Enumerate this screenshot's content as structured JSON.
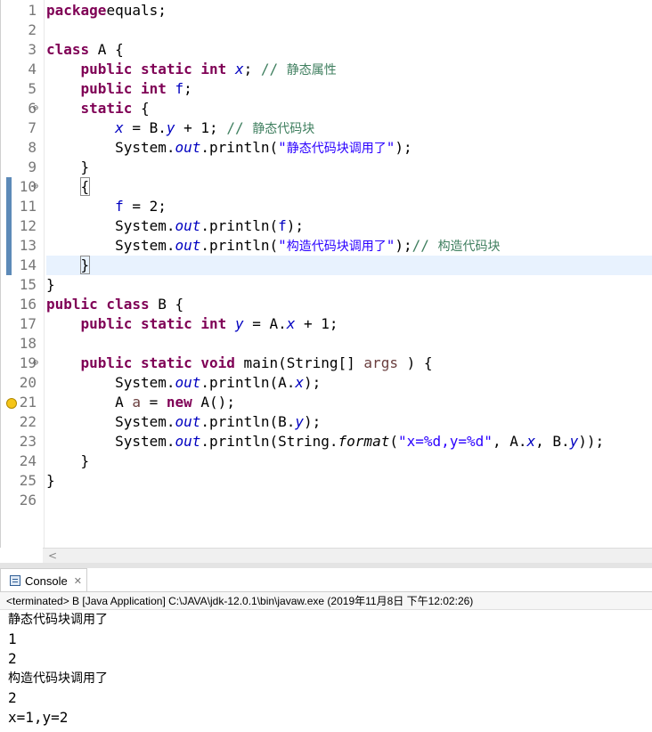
{
  "editor": {
    "line_numbers": [
      "1",
      "2",
      "3",
      "4",
      "5",
      "6",
      "7",
      "8",
      "9",
      "10",
      "11",
      "12",
      "13",
      "14",
      "15",
      "16",
      "17",
      "18",
      "19",
      "20",
      "21",
      "22",
      "23",
      "24",
      "25",
      "26"
    ],
    "lines": [
      [
        [
          "kw",
          "package"
        ],
        [
          "",
          "equals;"
        ]
      ],
      [],
      [
        [
          "kw",
          "class"
        ],
        [
          "",
          " A {"
        ]
      ],
      [
        [
          "",
          "    "
        ],
        [
          "kw",
          "public static int"
        ],
        [
          "",
          " "
        ],
        [
          "fld",
          "x"
        ],
        [
          "",
          "; "
        ],
        [
          "cmt",
          "// "
        ],
        [
          "cmt cn",
          "静态属性"
        ]
      ],
      [
        [
          "",
          "    "
        ],
        [
          "kw",
          "public int"
        ],
        [
          "",
          " "
        ],
        [
          "fldn",
          "f"
        ],
        [
          "",
          ";"
        ]
      ],
      [
        [
          "",
          "    "
        ],
        [
          "kw",
          "static"
        ],
        [
          "",
          " {"
        ]
      ],
      [
        [
          "",
          "        "
        ],
        [
          "fld",
          "x"
        ],
        [
          "",
          " = B."
        ],
        [
          "fld",
          "y"
        ],
        [
          "",
          " + 1; "
        ],
        [
          "cmt",
          "// "
        ],
        [
          "cmt cn",
          "静态代码块"
        ]
      ],
      [
        [
          "",
          "        System."
        ],
        [
          "fld",
          "out"
        ],
        [
          "",
          ".println("
        ],
        [
          "str",
          "\""
        ],
        [
          "str cn",
          "静态代码块调用了"
        ],
        [
          "str",
          "\""
        ],
        [
          "",
          ");"
        ]
      ],
      [
        [
          "",
          "    }"
        ]
      ],
      [
        [
          "",
          "    "
        ],
        [
          "brk",
          "{"
        ]
      ],
      [
        [
          "",
          "        "
        ],
        [
          "fldn",
          "f"
        ],
        [
          "",
          " = 2;"
        ]
      ],
      [
        [
          "",
          "        System."
        ],
        [
          "fld",
          "out"
        ],
        [
          "",
          ".println("
        ],
        [
          "fldn",
          "f"
        ],
        [
          "",
          ");"
        ]
      ],
      [
        [
          "",
          "        System."
        ],
        [
          "fld",
          "out"
        ],
        [
          "",
          ".println("
        ],
        [
          "str",
          "\""
        ],
        [
          "str cn",
          "构造代码块调用了"
        ],
        [
          "str",
          "\""
        ],
        [
          "",
          ");"
        ],
        [
          "cmt",
          "// "
        ],
        [
          "cmt cn",
          "构造代码块"
        ]
      ],
      [
        [
          "",
          "    "
        ],
        [
          "brk",
          "}"
        ],
        [
          "caret",
          ""
        ]
      ],
      [
        [
          "",
          "}"
        ]
      ],
      [
        [
          "kw",
          "public class"
        ],
        [
          "",
          " B {"
        ]
      ],
      [
        [
          "",
          "    "
        ],
        [
          "kw",
          "public static int"
        ],
        [
          "",
          " "
        ],
        [
          "fld",
          "y"
        ],
        [
          "",
          " = A."
        ],
        [
          "fld",
          "x"
        ],
        [
          "",
          " + 1;"
        ]
      ],
      [],
      [
        [
          "",
          "    "
        ],
        [
          "kw",
          "public static void"
        ],
        [
          "",
          " main(String[] "
        ],
        [
          "loc",
          "args"
        ],
        [
          "",
          " ) {"
        ]
      ],
      [
        [
          "",
          "        System."
        ],
        [
          "fld",
          "out"
        ],
        [
          "",
          ".println(A."
        ],
        [
          "fld",
          "x"
        ],
        [
          "",
          ");"
        ]
      ],
      [
        [
          "",
          "        A "
        ],
        [
          "loc",
          "a"
        ],
        [
          "",
          " = "
        ],
        [
          "kw",
          "new"
        ],
        [
          "",
          " A();"
        ]
      ],
      [
        [
          "",
          "        System."
        ],
        [
          "fld",
          "out"
        ],
        [
          "",
          ".println(B."
        ],
        [
          "fld",
          "y"
        ],
        [
          "",
          ");"
        ]
      ],
      [
        [
          "",
          "        System."
        ],
        [
          "fld",
          "out"
        ],
        [
          "",
          ".println(String."
        ],
        [
          "mth",
          "format"
        ],
        [
          "",
          "("
        ],
        [
          "str",
          "\"x=%d,y=%d\""
        ],
        [
          "",
          ", A."
        ],
        [
          "fld",
          "x"
        ],
        [
          "",
          ", B."
        ],
        [
          "fld",
          "y"
        ],
        [
          "",
          "));"
        ]
      ],
      [
        [
          "",
          "    }"
        ]
      ],
      [
        [
          "",
          "}"
        ]
      ],
      []
    ],
    "fold_icons": [
      "⊖",
      "⊖",
      "⊖"
    ],
    "scroll_left_arrow": "<"
  },
  "console": {
    "tab_label": "Console",
    "close_icon": "✕",
    "header": "<terminated> B [Java Application] C:\\JAVA\\jdk-12.0.1\\bin\\javaw.exe (2019年11月8日 下午12:02:26)",
    "output": [
      "静态代码块调用了",
      "1",
      "2",
      "构造代码块调用了",
      "2",
      "x=1,y=2"
    ]
  },
  "colors": {
    "keyword": "#7f0055",
    "field": "#0000c0",
    "string": "#2a00ff",
    "comment": "#3f7f5f",
    "current_line": "#e8f2fe",
    "change_marker": "#5d8ab8"
  },
  "icons": [
    "fold-collapse-icon",
    "warning-lightbulb-icon",
    "console-icon",
    "close-icon",
    "scroll-left-arrow-icon"
  ]
}
